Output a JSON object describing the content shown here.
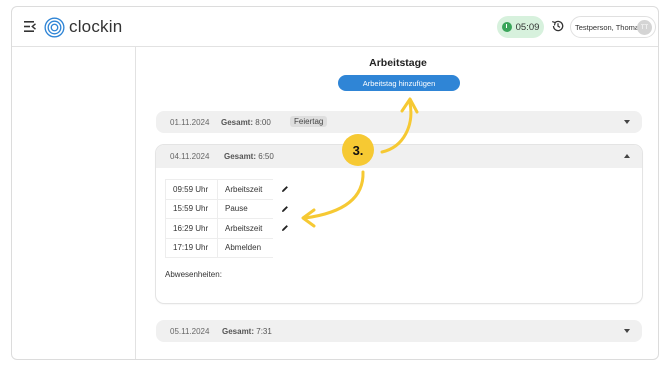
{
  "app": {
    "name": "clockin"
  },
  "header": {
    "timer": "05:09",
    "user_name": "Testperson, Thomas",
    "user_initials": "TT"
  },
  "main": {
    "title": "Arbeitstage",
    "add_button": "Arbeitstag hinzufügen",
    "days": [
      {
        "date": "01.11.2024",
        "total_label": "Gesamt:",
        "total": "8:00",
        "badge": "Feiertag"
      },
      {
        "date": "04.11.2024",
        "total_label": "Gesamt:",
        "total": "6:50",
        "entries": [
          {
            "time": "09:59 Uhr",
            "type": "Arbeitszeit"
          },
          {
            "time": "15:59 Uhr",
            "type": "Pause"
          },
          {
            "time": "16:29 Uhr",
            "type": "Arbeitszeit"
          },
          {
            "time": "17:19 Uhr",
            "type": "Abmelden"
          }
        ],
        "absences_label": "Abwesenheiten:"
      },
      {
        "date": "05.11.2024",
        "total_label": "Gesamt:",
        "total": "7:31"
      }
    ]
  },
  "annotation": {
    "step": "3."
  },
  "colors": {
    "primary": "#2f85d6",
    "timer_bg": "#d7f1dd",
    "timer_icon": "#3aa55a",
    "annotation": "#f6c933"
  }
}
